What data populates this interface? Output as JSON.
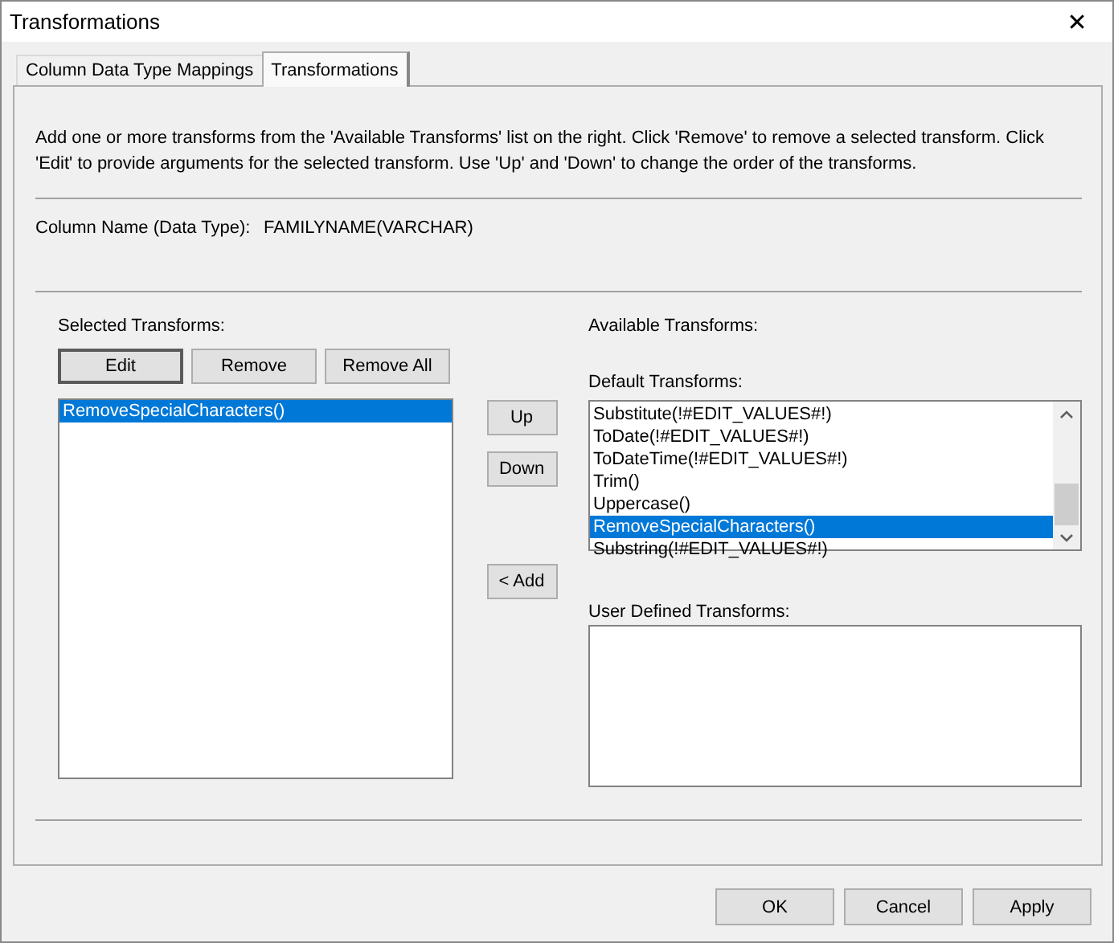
{
  "window": {
    "title": "Transformations",
    "close": "✕"
  },
  "tabs": [
    {
      "label": "Column Data Type Mappings",
      "selected": false
    },
    {
      "label": "Transformations",
      "selected": true
    }
  ],
  "description": "Add one or more transforms from the 'Available Transforms' list on the right. Click 'Remove' to remove a selected transform. Click 'Edit' to provide arguments for the selected transform. Use 'Up' and 'Down' to change the order of the transforms.",
  "column_name": {
    "label": "Column Name (Data Type):",
    "value": "FAMILYNAME(VARCHAR)"
  },
  "selected_transforms": {
    "label": "Selected Transforms:",
    "buttons": [
      "Edit",
      "Remove",
      "Remove All"
    ],
    "items": [
      {
        "label": "RemoveSpecialCharacters()",
        "selected": true
      }
    ]
  },
  "move_buttons": [
    "Up",
    "Down"
  ],
  "add_button": "< Add",
  "available_transforms": {
    "label": "Available Transforms:",
    "default_label": "Default Transforms:",
    "items": [
      {
        "label": "Substitute(!#EDIT_VALUES#!)",
        "selected": false
      },
      {
        "label": "ToDate(!#EDIT_VALUES#!)",
        "selected": false
      },
      {
        "label": "ToDateTime(!#EDIT_VALUES#!)",
        "selected": false
      },
      {
        "label": "Trim()",
        "selected": false
      },
      {
        "label": "Uppercase()",
        "selected": false
      },
      {
        "label": "RemoveSpecialCharacters()",
        "selected": true
      },
      {
        "label": "Substring(!#EDIT_VALUES#!)",
        "selected": false
      }
    ],
    "user_defined_label": "User Defined Transforms:"
  },
  "buttons": [
    "OK",
    "Cancel",
    "Apply"
  ]
}
